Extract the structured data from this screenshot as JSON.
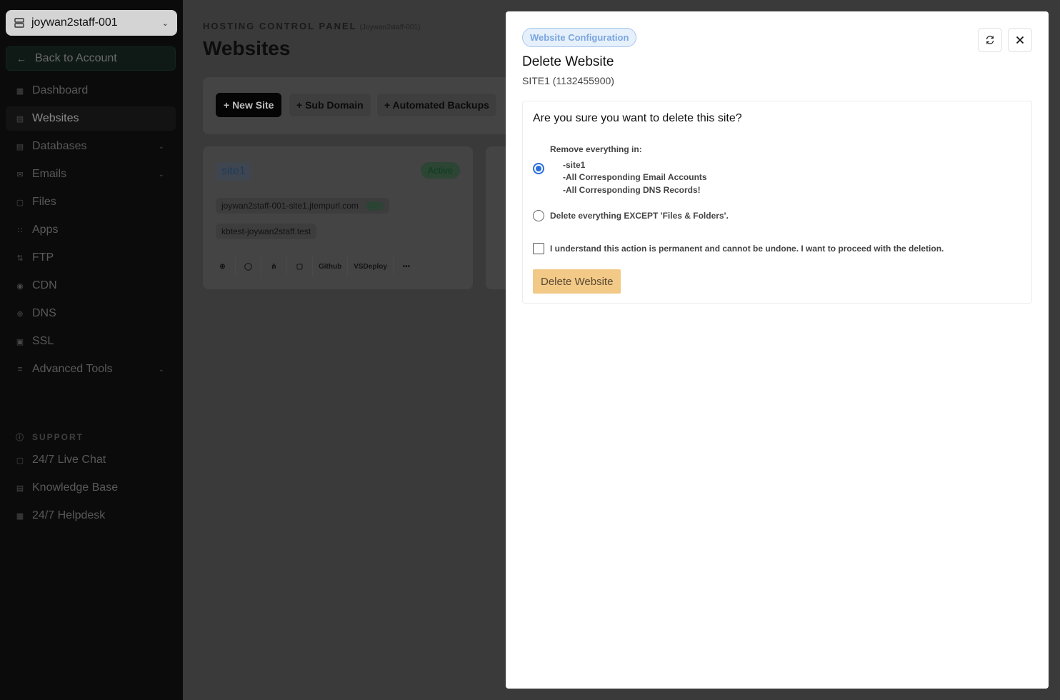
{
  "sidebar": {
    "account": "joywan2staff-001",
    "back_label": "Back to Account",
    "items": [
      {
        "label": "Dashboard",
        "icon": "grid-icon"
      },
      {
        "label": "Websites",
        "icon": "browser-icon"
      },
      {
        "label": "Databases",
        "icon": "database-icon"
      },
      {
        "label": "Emails",
        "icon": "mail-icon"
      },
      {
        "label": "Files",
        "icon": "folder-icon"
      },
      {
        "label": "Apps",
        "icon": "apps-icon"
      },
      {
        "label": "FTP",
        "icon": "ftp-icon"
      },
      {
        "label": "CDN",
        "icon": "cdn-icon"
      },
      {
        "label": "DNS",
        "icon": "globe-icon"
      },
      {
        "label": "SSL",
        "icon": "lock-icon"
      },
      {
        "label": "Advanced Tools",
        "icon": "tools-icon"
      }
    ],
    "support_heading": "SUPPORT",
    "support_items": [
      {
        "label": "24/7 Live Chat",
        "icon": "chat-icon"
      },
      {
        "label": "Knowledge Base",
        "icon": "book-icon"
      },
      {
        "label": "24/7 Helpdesk",
        "icon": "ticket-icon"
      }
    ]
  },
  "main": {
    "overline": "HOSTING CONTROL PANEL",
    "overline_sub": "(Joywan2staff-001)",
    "title": "Websites",
    "toolbar": {
      "new_site": "+ New Site",
      "sub_domain": "+ Sub Domain",
      "automated_backups": "+ Automated Backups"
    },
    "site_card": {
      "name": "site1",
      "status": "Active",
      "domain": "joywan2staff-001-site1.jtempurl.com",
      "ssl": "SSL",
      "alias": "kbtest-joywan2staff.test",
      "actions": {
        "github": "Github",
        "vsdeploy": "VSDeploy",
        "more": "•••"
      }
    }
  },
  "modal": {
    "badge": "Website Configuration",
    "title": "Delete Website",
    "subtitle": "SITE1 (1132455900)",
    "question": "Are you sure you want to delete this site?",
    "option1": {
      "label": "Remove everything in:",
      "details": [
        "-site1",
        "-All Corresponding Email Accounts",
        "-All Corresponding DNS Records!"
      ],
      "checked": true
    },
    "option2": {
      "label": "Delete everything EXCEPT 'Files & Folders'.",
      "checked": false
    },
    "acknowledge": "I understand this action is permanent and cannot be undone. I want to proceed with the deletion.",
    "delete_button": "Delete Website"
  },
  "colors": {
    "accent": "#2a6fdb",
    "delete_button_bg": "#f2c987",
    "badge_text": "#7aa6e0"
  }
}
